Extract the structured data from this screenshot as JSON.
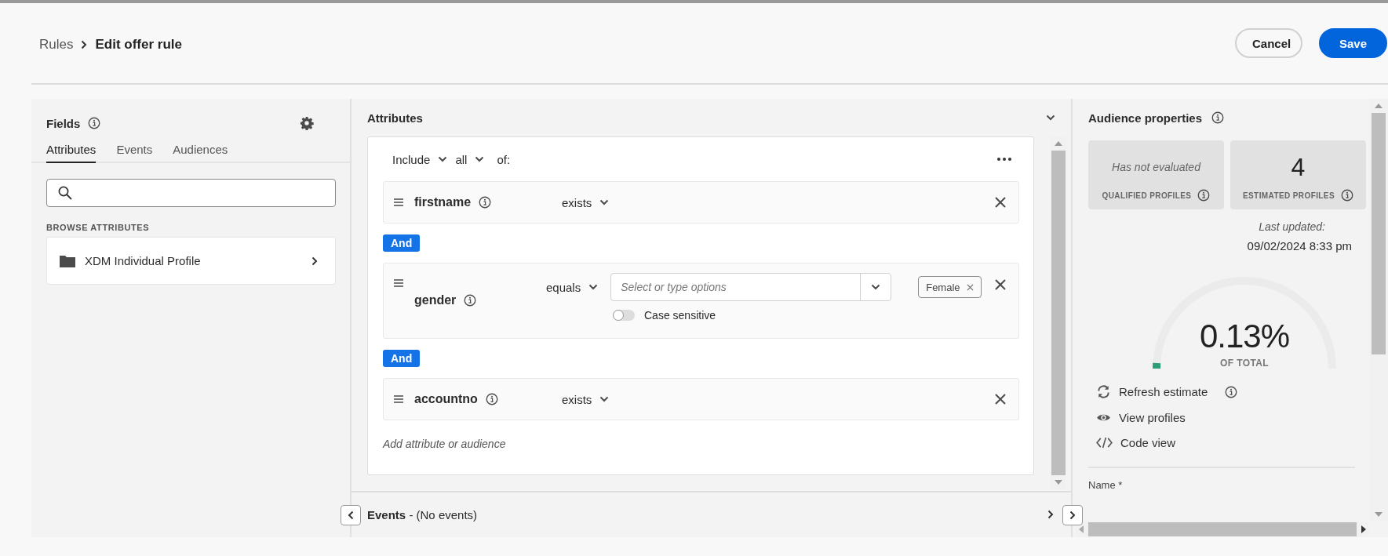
{
  "breadcrumb": {
    "parent": "Rules",
    "current": "Edit offer rule"
  },
  "actions": [
    {
      "label": "Cancel",
      "kind": "secondary"
    },
    {
      "label": "Save",
      "kind": "primary"
    }
  ],
  "fields_panel": {
    "title": "Fields",
    "tabs": [
      {
        "label": "Attributes",
        "selected": true
      },
      {
        "label": "Events",
        "selected": false
      },
      {
        "label": "Audiences",
        "selected": false
      }
    ],
    "section_label": "BROWSE ATTRIBUTES",
    "items": [
      {
        "label": "XDM Individual Profile"
      }
    ]
  },
  "attributes": {
    "title": "Attributes",
    "include": "Include",
    "quantifier": "all",
    "of_label": "of:",
    "conditions": [
      {
        "field": "firstname",
        "operator": "exists"
      },
      {
        "connector": "And",
        "field": "gender",
        "operator": "equals",
        "placeholder": "Select or type options",
        "tags": [
          "Female"
        ],
        "case_sensitive": false,
        "case_sensitive_label": "Case sensitive"
      },
      {
        "connector": "And",
        "field": "accountno",
        "operator": "exists"
      }
    ],
    "add_placeholder": "Add attribute or audience"
  },
  "events": {
    "title": "Events",
    "summary": "- (No events)"
  },
  "audience": {
    "title": "Audience properties",
    "tiles": [
      {
        "kind": "pending",
        "value": "Has not evaluated",
        "label": "QUALIFIED PROFILES"
      },
      {
        "kind": "count",
        "value": "4",
        "label": "ESTIMATED PROFILES"
      }
    ],
    "last_updated_label": "Last updated:",
    "last_updated": "09/02/2024 8:33 pm",
    "gauge": {
      "level": 0.0013,
      "value": "0.13%",
      "label": "OF TOTAL"
    },
    "links": [
      {
        "kind": "refresh",
        "label": "Refresh estimate",
        "info": true
      },
      {
        "kind": "view",
        "label": "View profiles",
        "info": false
      },
      {
        "kind": "code",
        "label": "Code view",
        "info": false
      }
    ],
    "name_label": "Name *"
  }
}
